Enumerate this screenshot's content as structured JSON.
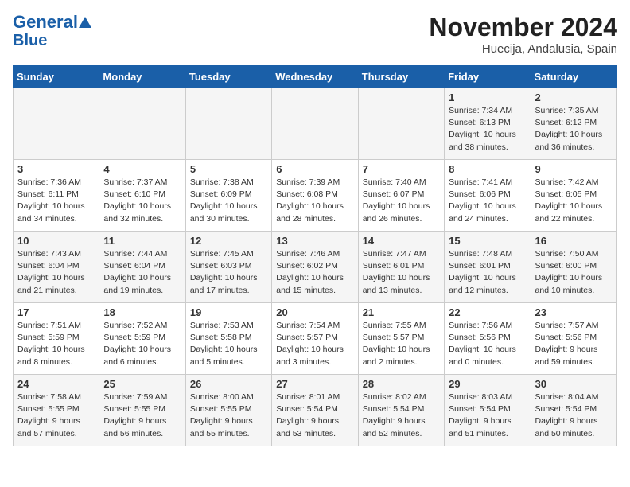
{
  "header": {
    "logo_line1": "General",
    "logo_line2": "Blue",
    "month": "November 2024",
    "location": "Huecija, Andalusia, Spain"
  },
  "columns": [
    "Sunday",
    "Monday",
    "Tuesday",
    "Wednesday",
    "Thursday",
    "Friday",
    "Saturday"
  ],
  "weeks": [
    [
      {
        "day": "",
        "info": ""
      },
      {
        "day": "",
        "info": ""
      },
      {
        "day": "",
        "info": ""
      },
      {
        "day": "",
        "info": ""
      },
      {
        "day": "",
        "info": ""
      },
      {
        "day": "1",
        "info": "Sunrise: 7:34 AM\nSunset: 6:13 PM\nDaylight: 10 hours\nand 38 minutes."
      },
      {
        "day": "2",
        "info": "Sunrise: 7:35 AM\nSunset: 6:12 PM\nDaylight: 10 hours\nand 36 minutes."
      }
    ],
    [
      {
        "day": "3",
        "info": "Sunrise: 7:36 AM\nSunset: 6:11 PM\nDaylight: 10 hours\nand 34 minutes."
      },
      {
        "day": "4",
        "info": "Sunrise: 7:37 AM\nSunset: 6:10 PM\nDaylight: 10 hours\nand 32 minutes."
      },
      {
        "day": "5",
        "info": "Sunrise: 7:38 AM\nSunset: 6:09 PM\nDaylight: 10 hours\nand 30 minutes."
      },
      {
        "day": "6",
        "info": "Sunrise: 7:39 AM\nSunset: 6:08 PM\nDaylight: 10 hours\nand 28 minutes."
      },
      {
        "day": "7",
        "info": "Sunrise: 7:40 AM\nSunset: 6:07 PM\nDaylight: 10 hours\nand 26 minutes."
      },
      {
        "day": "8",
        "info": "Sunrise: 7:41 AM\nSunset: 6:06 PM\nDaylight: 10 hours\nand 24 minutes."
      },
      {
        "day": "9",
        "info": "Sunrise: 7:42 AM\nSunset: 6:05 PM\nDaylight: 10 hours\nand 22 minutes."
      }
    ],
    [
      {
        "day": "10",
        "info": "Sunrise: 7:43 AM\nSunset: 6:04 PM\nDaylight: 10 hours\nand 21 minutes."
      },
      {
        "day": "11",
        "info": "Sunrise: 7:44 AM\nSunset: 6:04 PM\nDaylight: 10 hours\nand 19 minutes."
      },
      {
        "day": "12",
        "info": "Sunrise: 7:45 AM\nSunset: 6:03 PM\nDaylight: 10 hours\nand 17 minutes."
      },
      {
        "day": "13",
        "info": "Sunrise: 7:46 AM\nSunset: 6:02 PM\nDaylight: 10 hours\nand 15 minutes."
      },
      {
        "day": "14",
        "info": "Sunrise: 7:47 AM\nSunset: 6:01 PM\nDaylight: 10 hours\nand 13 minutes."
      },
      {
        "day": "15",
        "info": "Sunrise: 7:48 AM\nSunset: 6:01 PM\nDaylight: 10 hours\nand 12 minutes."
      },
      {
        "day": "16",
        "info": "Sunrise: 7:50 AM\nSunset: 6:00 PM\nDaylight: 10 hours\nand 10 minutes."
      }
    ],
    [
      {
        "day": "17",
        "info": "Sunrise: 7:51 AM\nSunset: 5:59 PM\nDaylight: 10 hours\nand 8 minutes."
      },
      {
        "day": "18",
        "info": "Sunrise: 7:52 AM\nSunset: 5:59 PM\nDaylight: 10 hours\nand 6 minutes."
      },
      {
        "day": "19",
        "info": "Sunrise: 7:53 AM\nSunset: 5:58 PM\nDaylight: 10 hours\nand 5 minutes."
      },
      {
        "day": "20",
        "info": "Sunrise: 7:54 AM\nSunset: 5:57 PM\nDaylight: 10 hours\nand 3 minutes."
      },
      {
        "day": "21",
        "info": "Sunrise: 7:55 AM\nSunset: 5:57 PM\nDaylight: 10 hours\nand 2 minutes."
      },
      {
        "day": "22",
        "info": "Sunrise: 7:56 AM\nSunset: 5:56 PM\nDaylight: 10 hours\nand 0 minutes."
      },
      {
        "day": "23",
        "info": "Sunrise: 7:57 AM\nSunset: 5:56 PM\nDaylight: 9 hours\nand 59 minutes."
      }
    ],
    [
      {
        "day": "24",
        "info": "Sunrise: 7:58 AM\nSunset: 5:55 PM\nDaylight: 9 hours\nand 57 minutes."
      },
      {
        "day": "25",
        "info": "Sunrise: 7:59 AM\nSunset: 5:55 PM\nDaylight: 9 hours\nand 56 minutes."
      },
      {
        "day": "26",
        "info": "Sunrise: 8:00 AM\nSunset: 5:55 PM\nDaylight: 9 hours\nand 55 minutes."
      },
      {
        "day": "27",
        "info": "Sunrise: 8:01 AM\nSunset: 5:54 PM\nDaylight: 9 hours\nand 53 minutes."
      },
      {
        "day": "28",
        "info": "Sunrise: 8:02 AM\nSunset: 5:54 PM\nDaylight: 9 hours\nand 52 minutes."
      },
      {
        "day": "29",
        "info": "Sunrise: 8:03 AM\nSunset: 5:54 PM\nDaylight: 9 hours\nand 51 minutes."
      },
      {
        "day": "30",
        "info": "Sunrise: 8:04 AM\nSunset: 5:54 PM\nDaylight: 9 hours\nand 50 minutes."
      }
    ]
  ]
}
